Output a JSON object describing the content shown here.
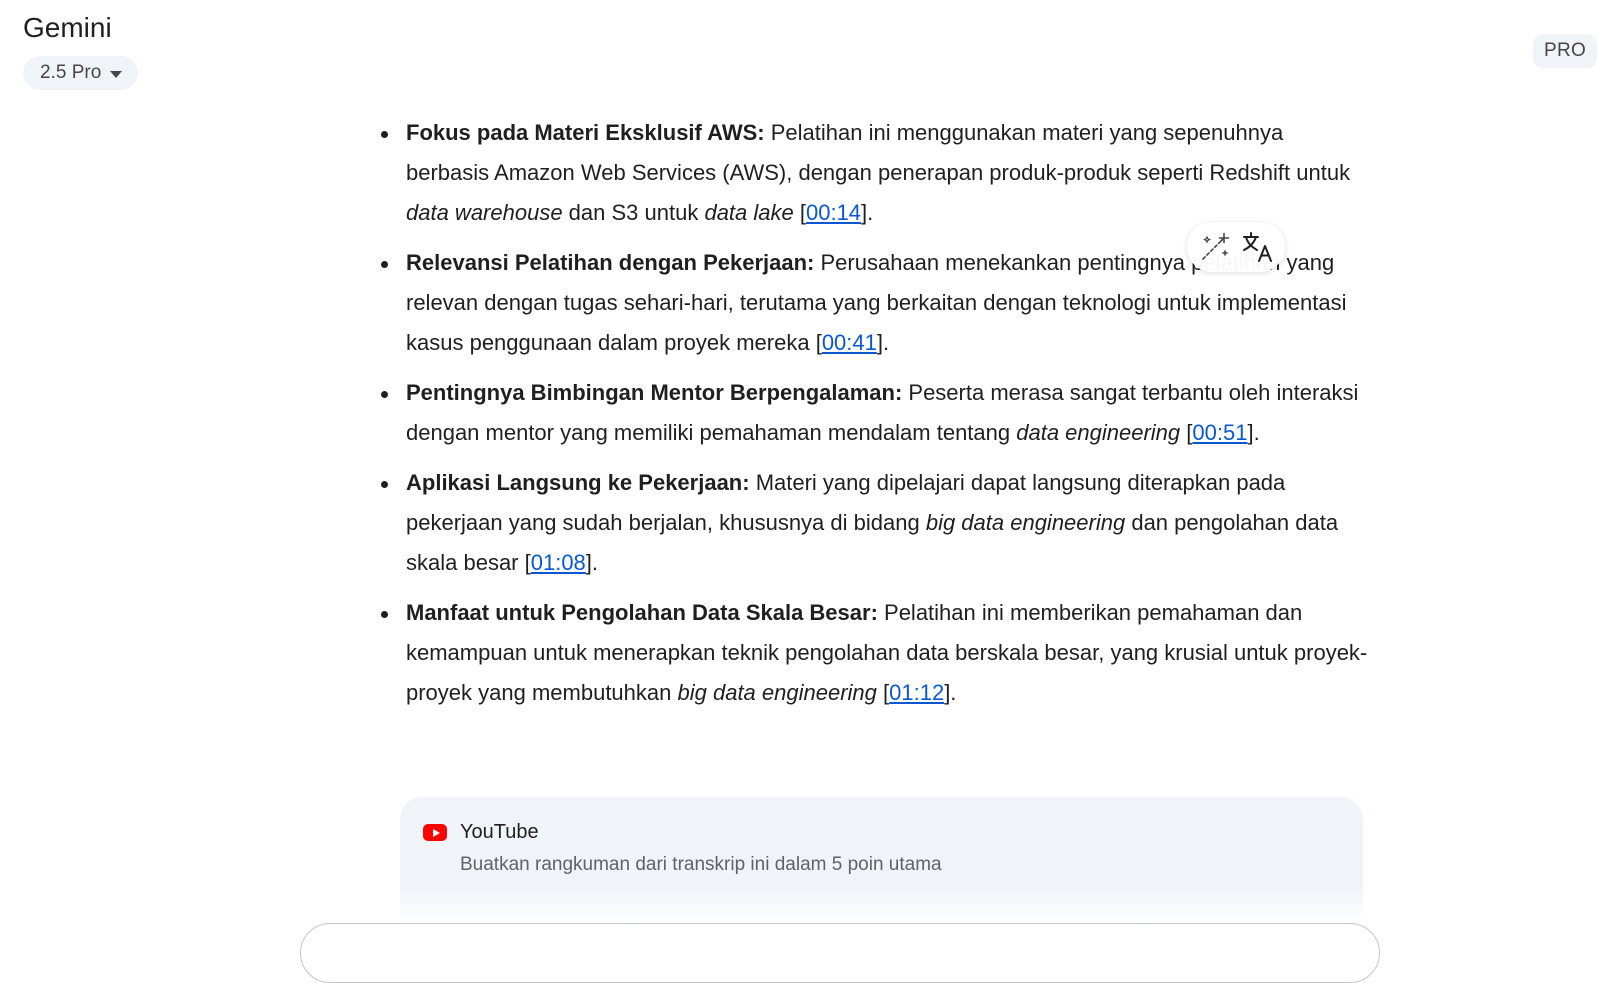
{
  "header": {
    "app_title": "Gemini",
    "model": "2.5 Pro",
    "pro_badge": "PRO"
  },
  "summary_points": [
    {
      "title": "Fokus pada Materi Eksklusif AWS:",
      "text_1": " Pelatihan ini menggunakan materi yang sepenuhnya berbasis Amazon Web Services (AWS), dengan penerapan produk-produk seperti Redshift untuk ",
      "italic_1": "data warehouse",
      "text_2": " dan S3 untuk ",
      "italic_2": "data lake",
      "text_3": " [",
      "timestamp": "00:14",
      "text_end": "]."
    },
    {
      "title": "Relevansi Pelatihan dengan Pekerjaan:",
      "text_1": " Perusahaan menekankan pentingnya pelatihan yang relevan dengan tugas sehari-hari, terutama yang berkaitan dengan teknologi untuk implementasi kasus penggunaan dalam proyek mereka [",
      "timestamp": "00:41",
      "text_end": "]."
    },
    {
      "title": "Pentingnya Bimbingan Mentor Berpengalaman:",
      "text_1": " Peserta merasa sangat terbantu oleh interaksi dengan mentor yang memiliki pemahaman mendalam tentang ",
      "italic_1": "data engineering",
      "text_2": " [",
      "timestamp": "00:51",
      "text_end": "]."
    },
    {
      "title": "Aplikasi Langsung ke Pekerjaan:",
      "text_1": " Materi yang dipelajari dapat langsung diterapkan pada pekerjaan yang sudah berjalan, khususnya di bidang ",
      "italic_1": "big data engineering",
      "text_2": " dan pengolahan data skala besar [",
      "timestamp": "01:08",
      "text_end": "]."
    },
    {
      "title": "Manfaat untuk Pengolahan Data Skala Besar:",
      "text_1": " Pelatihan ini memberikan pemahaman dan kemampuan untuk menerapkan teknik pengolahan data berskala besar, yang krusial untuk proyek-proyek yang membutuhkan ",
      "italic_1": "big data engineering",
      "text_2": " [",
      "timestamp": "01:12",
      "text_end": "]."
    }
  ],
  "floating_toolbar": {
    "icons": [
      "magic-wand-icon",
      "translate-icon"
    ]
  },
  "source_card": {
    "icon": "youtube-icon",
    "source_name": "YouTube",
    "prompt": "Buatkan rangkuman dari transkrip ini dalam 5 poin utama"
  },
  "colors": {
    "link": "#0b57d0",
    "chip_bg": "#f0f4f9",
    "youtube_red": "#ff0000"
  }
}
